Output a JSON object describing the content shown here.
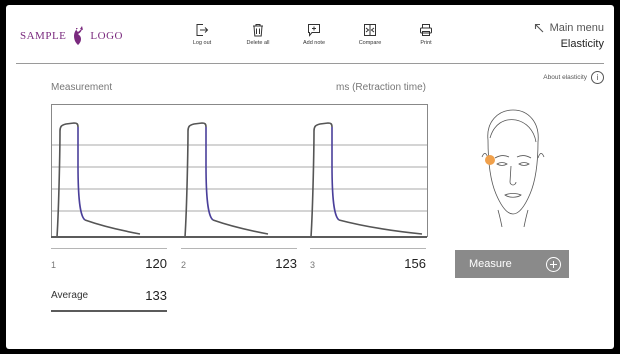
{
  "logo": {
    "left": "SAMPLE",
    "right": "LOGO"
  },
  "toolbar": [
    {
      "label": "Log out",
      "icon": "logout-icon"
    },
    {
      "label": "Delete all",
      "icon": "trash-icon"
    },
    {
      "label": "Add note",
      "icon": "add-note-icon"
    },
    {
      "label": "Compare",
      "icon": "compare-icon"
    },
    {
      "label": "Print",
      "icon": "print-icon"
    }
  ],
  "main_menu": {
    "label": "Main menu",
    "current": "Elasticity",
    "icon": "arrow-up-left-icon"
  },
  "about": {
    "label": "About elasticity",
    "icon": "info-icon"
  },
  "panel": {
    "left_label": "Measurement",
    "right_label": "ms (Retraction time)"
  },
  "results": [
    {
      "index": "1",
      "value": "120"
    },
    {
      "index": "2",
      "value": "123"
    },
    {
      "index": "3",
      "value": "156"
    }
  ],
  "average": {
    "label": "Average",
    "value": "133"
  },
  "measure_button": {
    "label": "Measure",
    "icon": "plus-circle-icon"
  },
  "colors": {
    "accent": "#7a2a7e",
    "curve_highlight": "#4a3f9a",
    "curve": "#555555",
    "probe": "#f0a04b",
    "button": "#8a8a8a"
  }
}
